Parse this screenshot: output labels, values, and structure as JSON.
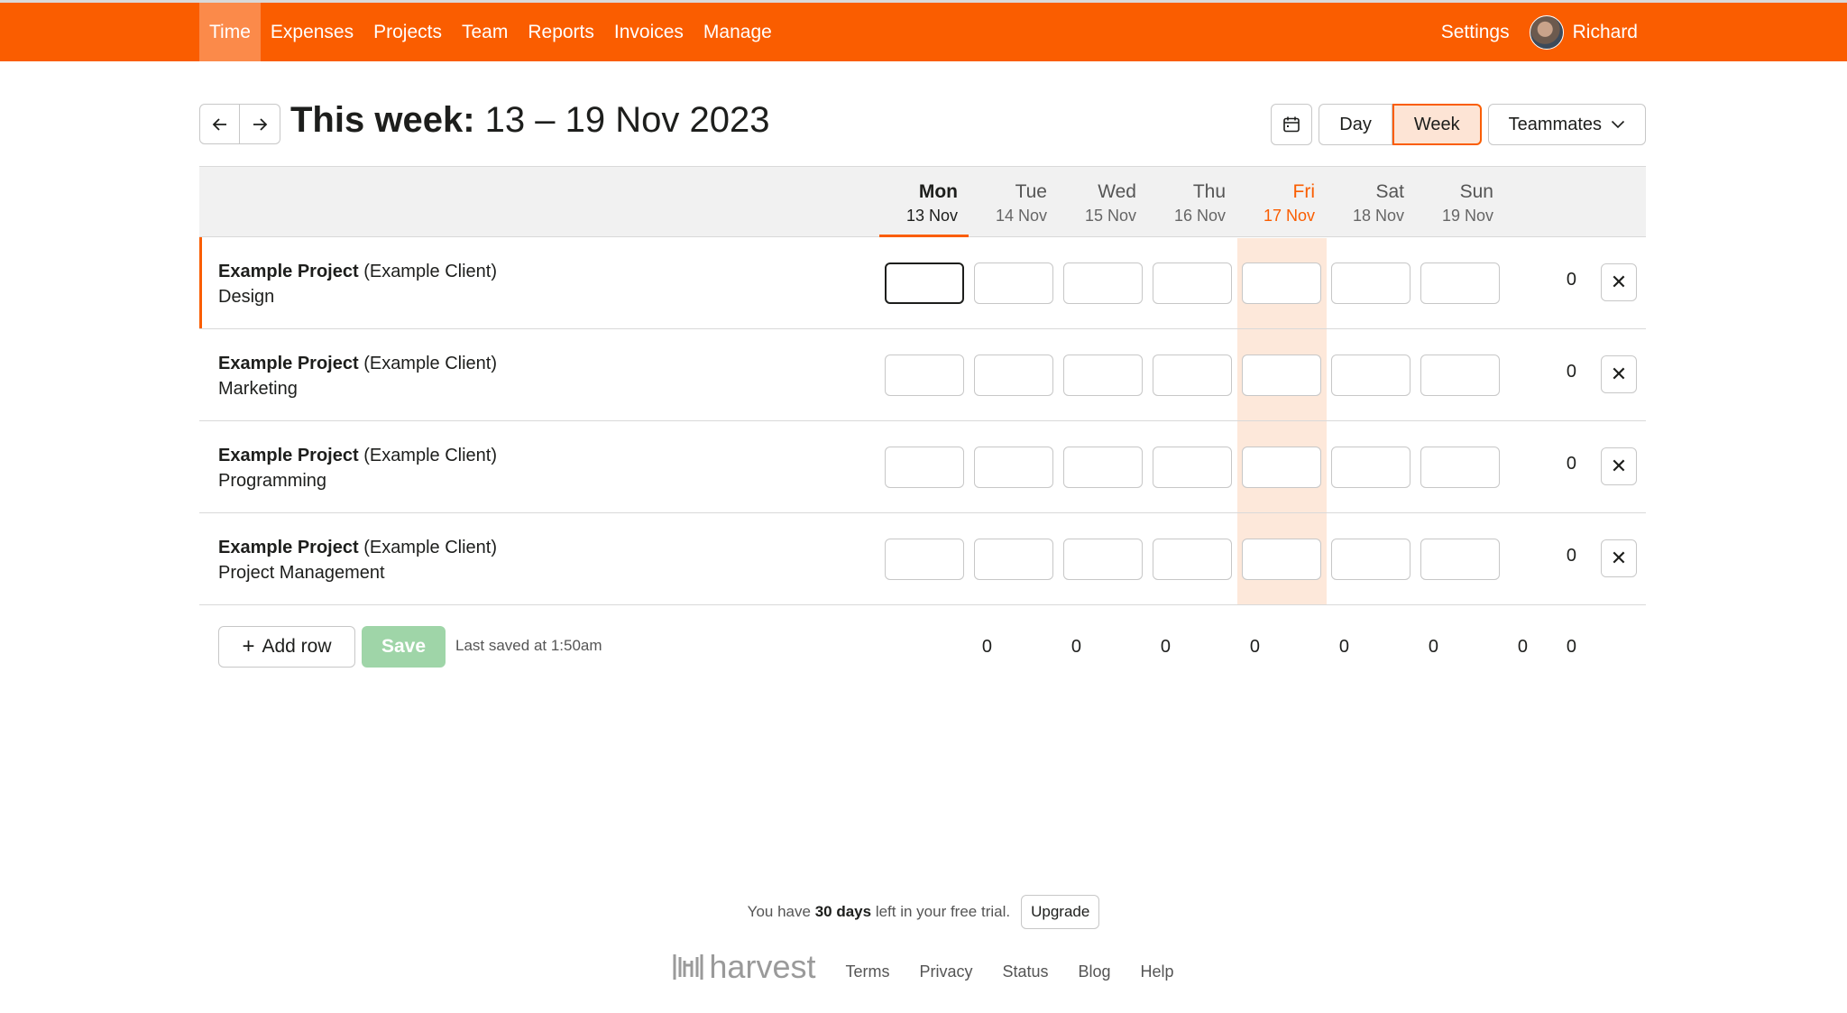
{
  "nav": {
    "items": [
      {
        "label": "Time",
        "active": true
      },
      {
        "label": "Expenses",
        "active": false
      },
      {
        "label": "Projects",
        "active": false
      },
      {
        "label": "Team",
        "active": false
      },
      {
        "label": "Reports",
        "active": false
      },
      {
        "label": "Invoices",
        "active": false
      },
      {
        "label": "Manage",
        "active": false
      }
    ],
    "settings_label": "Settings",
    "user_name": "Richard"
  },
  "header": {
    "title_prefix": "This week:",
    "title_range": "13 – 19 Nov 2023",
    "day_label": "Day",
    "week_label": "Week",
    "teammates_label": "Teammates"
  },
  "days": [
    {
      "name": "Mon",
      "date": "13 Nov"
    },
    {
      "name": "Tue",
      "date": "14 Nov"
    },
    {
      "name": "Wed",
      "date": "15 Nov"
    },
    {
      "name": "Thu",
      "date": "16 Nov"
    },
    {
      "name": "Fri",
      "date": "17 Nov"
    },
    {
      "name": "Sat",
      "date": "18 Nov"
    },
    {
      "name": "Sun",
      "date": "19 Nov"
    }
  ],
  "rows": [
    {
      "project": "Example Project",
      "client": "(Example Client)",
      "task": "Design",
      "total": "0"
    },
    {
      "project": "Example Project",
      "client": "(Example Client)",
      "task": "Marketing",
      "total": "0"
    },
    {
      "project": "Example Project",
      "client": "(Example Client)",
      "task": "Programming",
      "total": "0"
    },
    {
      "project": "Example Project",
      "client": "(Example Client)",
      "task": "Project Management",
      "total": "0"
    }
  ],
  "footer_row": {
    "add_row_label": "Add row",
    "save_label": "Save",
    "last_saved": "Last saved at 1:50am",
    "day_totals": [
      "0",
      "0",
      "0",
      "0",
      "0",
      "0",
      "0"
    ],
    "grand_total": "0"
  },
  "trial": {
    "prefix": "You have",
    "days": "30 days",
    "suffix": "left in your free trial.",
    "upgrade_label": "Upgrade"
  },
  "bottom": {
    "logo_text": "harvest",
    "links": [
      "Terms",
      "Privacy",
      "Status",
      "Blog",
      "Help"
    ]
  },
  "colors": {
    "brand": "#fa5d00",
    "today_band": "#fde8da",
    "save_disabled": "#9fd5a8"
  }
}
